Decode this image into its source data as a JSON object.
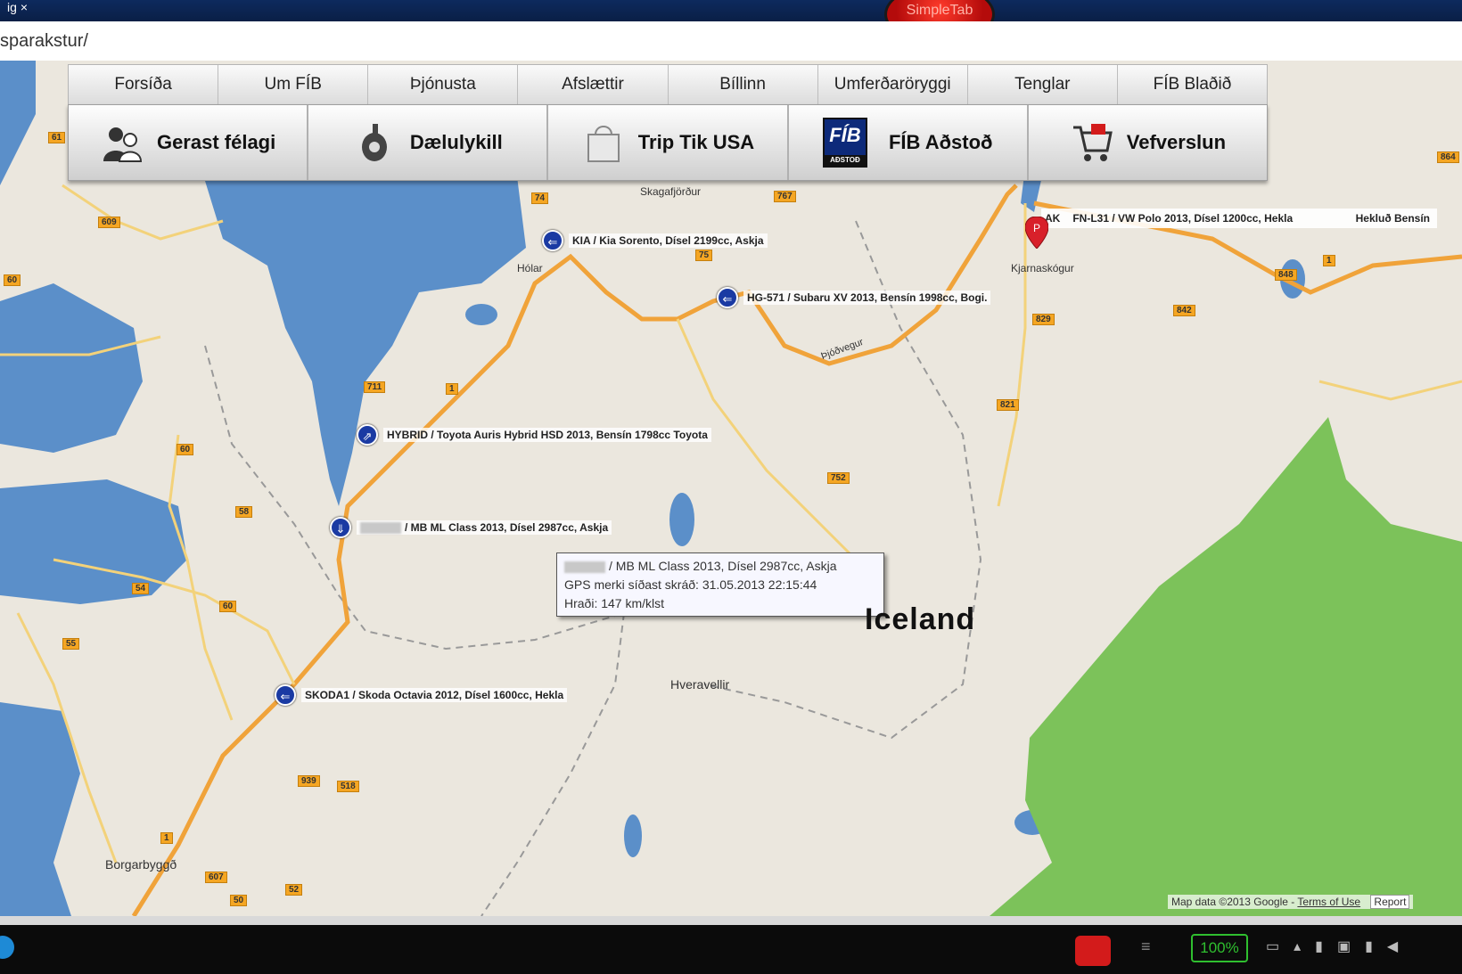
{
  "browser": {
    "tab_fragment": "ig",
    "tab_close": "×",
    "extension_label": "SimpleTab",
    "url_fragment": "sparakstur/"
  },
  "nav": {
    "items": [
      "Forsíða",
      "Um FÍB",
      "Þjónusta",
      "Afslættir",
      "Bíllinn",
      "Umferðaröryggi",
      "Tenglar",
      "FÍB Blaðið"
    ]
  },
  "toolbar": {
    "items": [
      {
        "label": "Gerast félagi",
        "icon": "members-icon"
      },
      {
        "label": "Dælulykill",
        "icon": "key-tag-icon"
      },
      {
        "label": "Trip Tik USA",
        "icon": "bag-icon"
      },
      {
        "label": "FÍB Aðstoð",
        "icon": "fib-logo-icon"
      },
      {
        "label": "Vefverslun",
        "icon": "cart-icon"
      }
    ],
    "fib_logo_text": "FÍB",
    "fib_logo_sub": "AÐSTOÐ"
  },
  "map": {
    "country_label": "Iceland",
    "places": [
      "Skagafjörður",
      "Hólar",
      "Kjarnaskógur",
      "Hveravellir",
      "Borgarbyggð",
      "Þjóðvegur"
    ],
    "cars": [
      {
        "label": "KIA / Kia Sorento, Dísel 2199cc, Askja"
      },
      {
        "label": "HG-571 / Subaru XV 2013, Bensín 1998cc, Bogi."
      },
      {
        "label": "HYBRID / Toyota Auris Hybrid HSD 2013, Bensín 1798cc Toyota"
      },
      {
        "label": "/ MB ML Class 2013, Dísel 2987cc, Askja"
      },
      {
        "label": "SKODA1 / Skoda Octavia 2012, Dísel 1600cc, Hekla"
      }
    ],
    "red_marker": {
      "label": "FN-L31 / VW Polo 2013, Dísel 1200cc, Hekla",
      "label_prefix": "AK",
      "label_extra": "Hekluð Bensín"
    },
    "popup": {
      "line1": "/ MB ML Class 2013, Dísel 2987cc, Askja",
      "line2": "GPS merki síðast skráð: 31.05.2013 22:15:44",
      "line3": "Hraði: 147 km/klst"
    },
    "attribution": {
      "text": "Map data ©2013 Google -",
      "terms": "Terms of Use",
      "report": "Report"
    },
    "road_numbers": [
      "61",
      "609",
      "60",
      "74",
      "711",
      "1",
      "75",
      "767",
      "829",
      "842",
      "821",
      "752",
      "60",
      "58",
      "54",
      "55",
      "60",
      "1",
      "939",
      "518",
      "607",
      "52",
      "50",
      "848",
      "1",
      "864"
    ],
    "colors": {
      "water": "#5b8fc9",
      "land": "#ebe7de",
      "park": "#7cc25a",
      "road": "#f0a33a",
      "marker": "#1a3aa3",
      "pin": "#d8202a"
    }
  },
  "taskbar": {
    "battery": "100%"
  }
}
